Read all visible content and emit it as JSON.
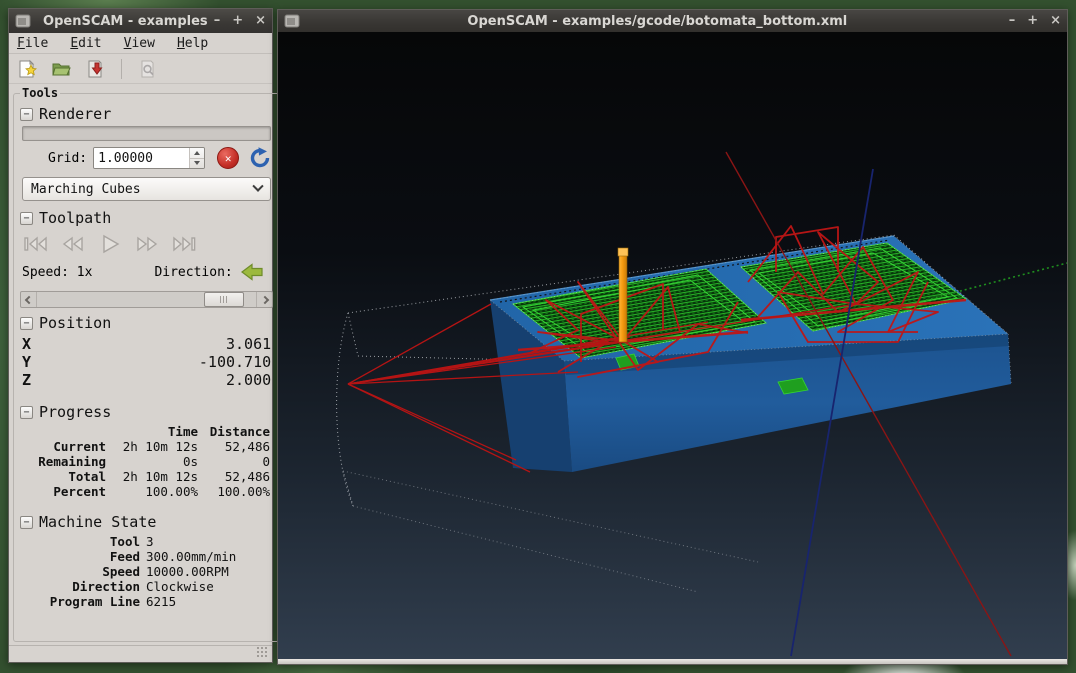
{
  "ui": {
    "collapse_glyph": "−",
    "cancel_glyph": "✕"
  },
  "colors": {
    "titlebar": "#3a3835",
    "panel_bg": "#d7d3cf",
    "viewport_top": "#060708",
    "viewport_bottom": "#313e4e",
    "stock_blue": "#2165a8",
    "toolpath_green": "#27b427",
    "rapid_red": "#bf1616",
    "tool_orange": "#f59a10",
    "axis_red": "#8a1515",
    "axis_green": "#1f8f1f",
    "axis_blue": "#18246e",
    "cancel_red": "#c42f27",
    "refresh_blue": "#2d62b0",
    "direction_green": "#9cb93e"
  },
  "left_window": {
    "title": "OpenSCAM - examples",
    "buttons": {
      "minimize": "–",
      "maximize": "+",
      "close": "×"
    },
    "menu": [
      {
        "key": "F",
        "rest": "ile"
      },
      {
        "key": "E",
        "rest": "dit"
      },
      {
        "key": "V",
        "rest": "iew"
      },
      {
        "key": "H",
        "rest": "elp"
      }
    ],
    "tools": {
      "label": "Tools",
      "renderer": {
        "title": "Renderer",
        "grid_label": "Grid:",
        "grid_value": "1.00000",
        "algorithm": "Marching Cubes"
      },
      "toolpath": {
        "title": "Toolpath",
        "speed_label": "Speed: 1x",
        "direction_label": "Direction:"
      },
      "position": {
        "title": "Position",
        "rows": [
          {
            "axis": "X",
            "value": "3.061"
          },
          {
            "axis": "Y",
            "value": "-100.710"
          },
          {
            "axis": "Z",
            "value": "2.000"
          }
        ]
      },
      "progress": {
        "title": "Progress",
        "col_time": "Time",
        "col_distance": "Distance",
        "rows": [
          {
            "label": "Current",
            "time": "2h 10m 12s",
            "distance": "52,486"
          },
          {
            "label": "Remaining",
            "time": "0s",
            "distance": "0"
          },
          {
            "label": "Total",
            "time": "2h 10m 12s",
            "distance": "52,486"
          },
          {
            "label": "Percent",
            "time": "100.00%",
            "distance": "100.00%"
          }
        ]
      },
      "machine_state": {
        "title": "Machine State",
        "rows": [
          {
            "label": "Tool",
            "value": "3"
          },
          {
            "label": "Feed",
            "value": "300.00mm/min"
          },
          {
            "label": "Speed",
            "value": "10000.00RPM"
          },
          {
            "label": "Direction",
            "value": "Clockwise"
          },
          {
            "label": "Program Line",
            "value": "6215"
          }
        ]
      }
    }
  },
  "right_window": {
    "title": "OpenSCAM - examples/gcode/botomata_bottom.xml",
    "buttons": {
      "minimize": "–",
      "maximize": "+",
      "close": "×"
    }
  }
}
